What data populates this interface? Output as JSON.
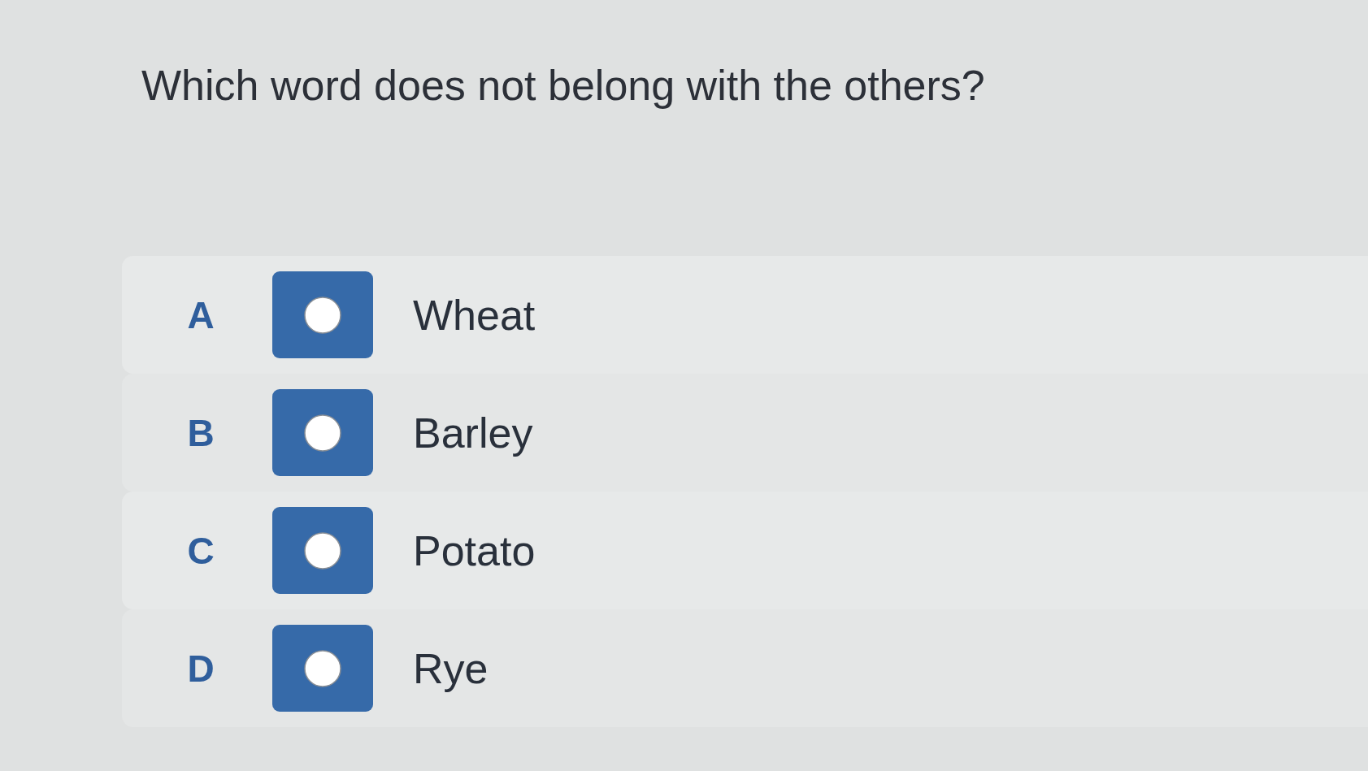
{
  "question": "Which word does not belong with the others?",
  "options": [
    {
      "letter": "A",
      "label": "Wheat",
      "selected": false
    },
    {
      "letter": "B",
      "label": "Barley",
      "selected": false
    },
    {
      "letter": "C",
      "label": "Potato",
      "selected": false
    },
    {
      "letter": "D",
      "label": "Rye",
      "selected": false
    }
  ]
}
